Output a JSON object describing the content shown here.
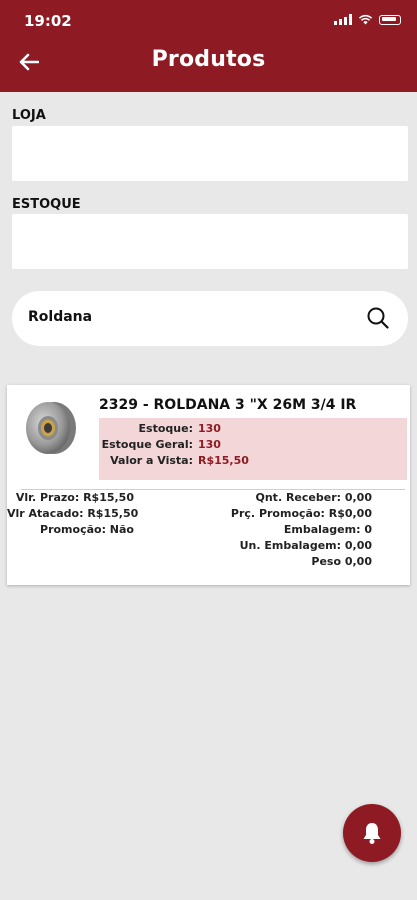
{
  "status_bar": {
    "time": "19:02"
  },
  "header": {
    "title": "Produtos",
    "back_icon": "arrow-left-icon"
  },
  "filters": {
    "loja_label": "LOJA",
    "loja_value": "",
    "estoque_label": "ESTOQUE",
    "estoque_value": ""
  },
  "search": {
    "value": "Roldana",
    "icon": "search-icon"
  },
  "product": {
    "title": "2329 - ROLDANA 3 \"X 26M 3/4 IR",
    "stock": [
      {
        "label": "Estoque:",
        "value": "130"
      },
      {
        "label": "Estoque Geral:",
        "value": "130"
      },
      {
        "label": "Valor a Vista:",
        "value": "R$15,50"
      }
    ],
    "left_details": [
      "Vlr. Prazo: R$15,50",
      "Vlr Atacado: R$15,50",
      "Promoção: Não"
    ],
    "right_details": [
      "Qnt. Receber: 0,00",
      "Prç. Promoção: R$0,00",
      "Embalagem: 0",
      "Un. Embalagem: 0,00",
      "Peso 0,00"
    ]
  },
  "fab": {
    "icon": "bell-icon"
  },
  "colors": {
    "primary": "#8e1b23",
    "highlight": "#f2d6d8",
    "background": "#e8e8e8"
  }
}
